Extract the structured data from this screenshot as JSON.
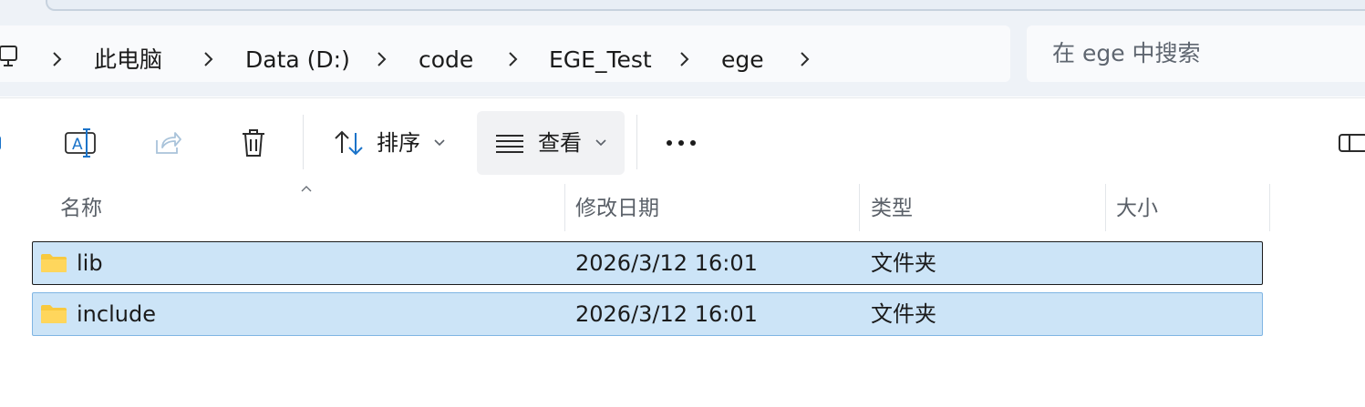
{
  "address_bar": {
    "breadcrumbs": [
      "此电脑",
      "Data (D:)",
      "code",
      "EGE_Test",
      "ege"
    ],
    "root_icon": "computer-icon"
  },
  "search": {
    "placeholder": "在 ege 中搜索"
  },
  "toolbar": {
    "new_icon": "new-item-icon",
    "rename_icon": "rename-icon",
    "share_icon": "share-icon",
    "delete_icon": "delete-icon",
    "sort_label": "排序",
    "sort_icon": "sort-icon",
    "view_label": "查看",
    "view_icon": "list-view-icon",
    "more_icon": "more-options-icon",
    "details_pane_icon": "details-pane-icon"
  },
  "columns": {
    "name": "名称",
    "modified": "修改日期",
    "type": "类型",
    "size": "大小",
    "sorted_by": "name"
  },
  "files": [
    {
      "name": "lib",
      "modified": "2026/3/12 16:01",
      "type": "文件夹",
      "size": "",
      "icon": "folder-icon",
      "selected": true,
      "focused": true
    },
    {
      "name": "include",
      "modified": "2026/3/12 16:01",
      "type": "文件夹",
      "size": "",
      "icon": "folder-icon",
      "selected": true,
      "focused": false
    }
  ],
  "colors": {
    "selection": "#cce4f7",
    "accent": "#1a73c9",
    "folder": "#f8c93e"
  }
}
